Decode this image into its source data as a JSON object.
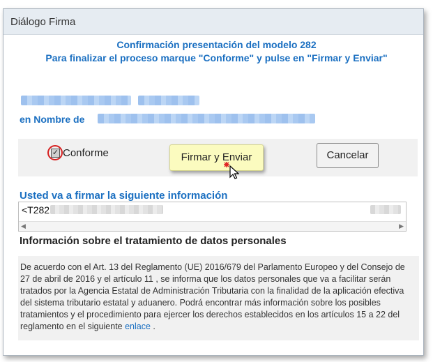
{
  "dialog": {
    "title": "Diálogo Firma",
    "heading_line1": "Confirmación presentación del modelo 282",
    "heading_line2": "Para finalizar el proceso marque \"Conforme\" y pulse en \"Firmar y Enviar\"",
    "on_behalf_label": "en Nombre de",
    "conforme_label": "Conforme",
    "conforme_checked": true,
    "sign_button": "Firmar y Enviar",
    "cancel_button": "Cancelar",
    "info_heading": "Usted va a firmar la siguiente información",
    "info_text_visible": "<T282",
    "privacy_heading": "Información sobre el tratamiento de datos personales",
    "privacy_text": "De acuerdo con el Art. 13 del Reglamento (UE) 2016/679 del Parlamento Europeo y del Consejo de 27 de abril de 2016 y el artículo 11 , se informa que los datos personales que va a facilitar serán tratados por la Agencia Estatal de Administración Tributaria con la finalidad de la aplicación efectiva del sistema tributario estatal y aduanero. Podrá encontrar más información sobre los posibles tratamientos y el procedimiento para ejercer los derechos establecidos en los artículos 15 a 22 del reglamento en el siguiente",
    "privacy_link": "enlace",
    "privacy_text_end": " ."
  },
  "colors": {
    "accent": "#1a6fc1",
    "sign_button_bg": "#fbfbbf",
    "highlight_circle": "#d62020"
  },
  "icons": {
    "cursor": "arrow-cursor-icon",
    "click_marker": "click-star-icon",
    "scroll_left": "chevron-left-icon",
    "scroll_right": "chevron-right-icon"
  }
}
